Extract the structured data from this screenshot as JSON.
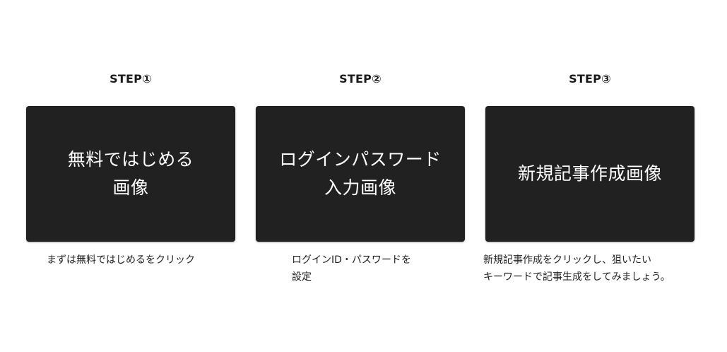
{
  "steps": [
    {
      "title": "STEP①",
      "card_text": "無料ではじめる\n画像",
      "description": "まずは無料ではじめるをクリック"
    },
    {
      "title": "STEP②",
      "card_text": "ログインパスワード\n入力画像",
      "description": "ログインID・パスワードを\n設定"
    },
    {
      "title": "STEP③",
      "card_text": "新規記事作成画像",
      "description": "新規記事作成をクリックし、狙いたい\nキーワードで記事生成をしてみましょう。"
    }
  ],
  "colors": {
    "card_background": "#212121",
    "card_text": "#ffffff",
    "page_background": "#ffffff"
  }
}
